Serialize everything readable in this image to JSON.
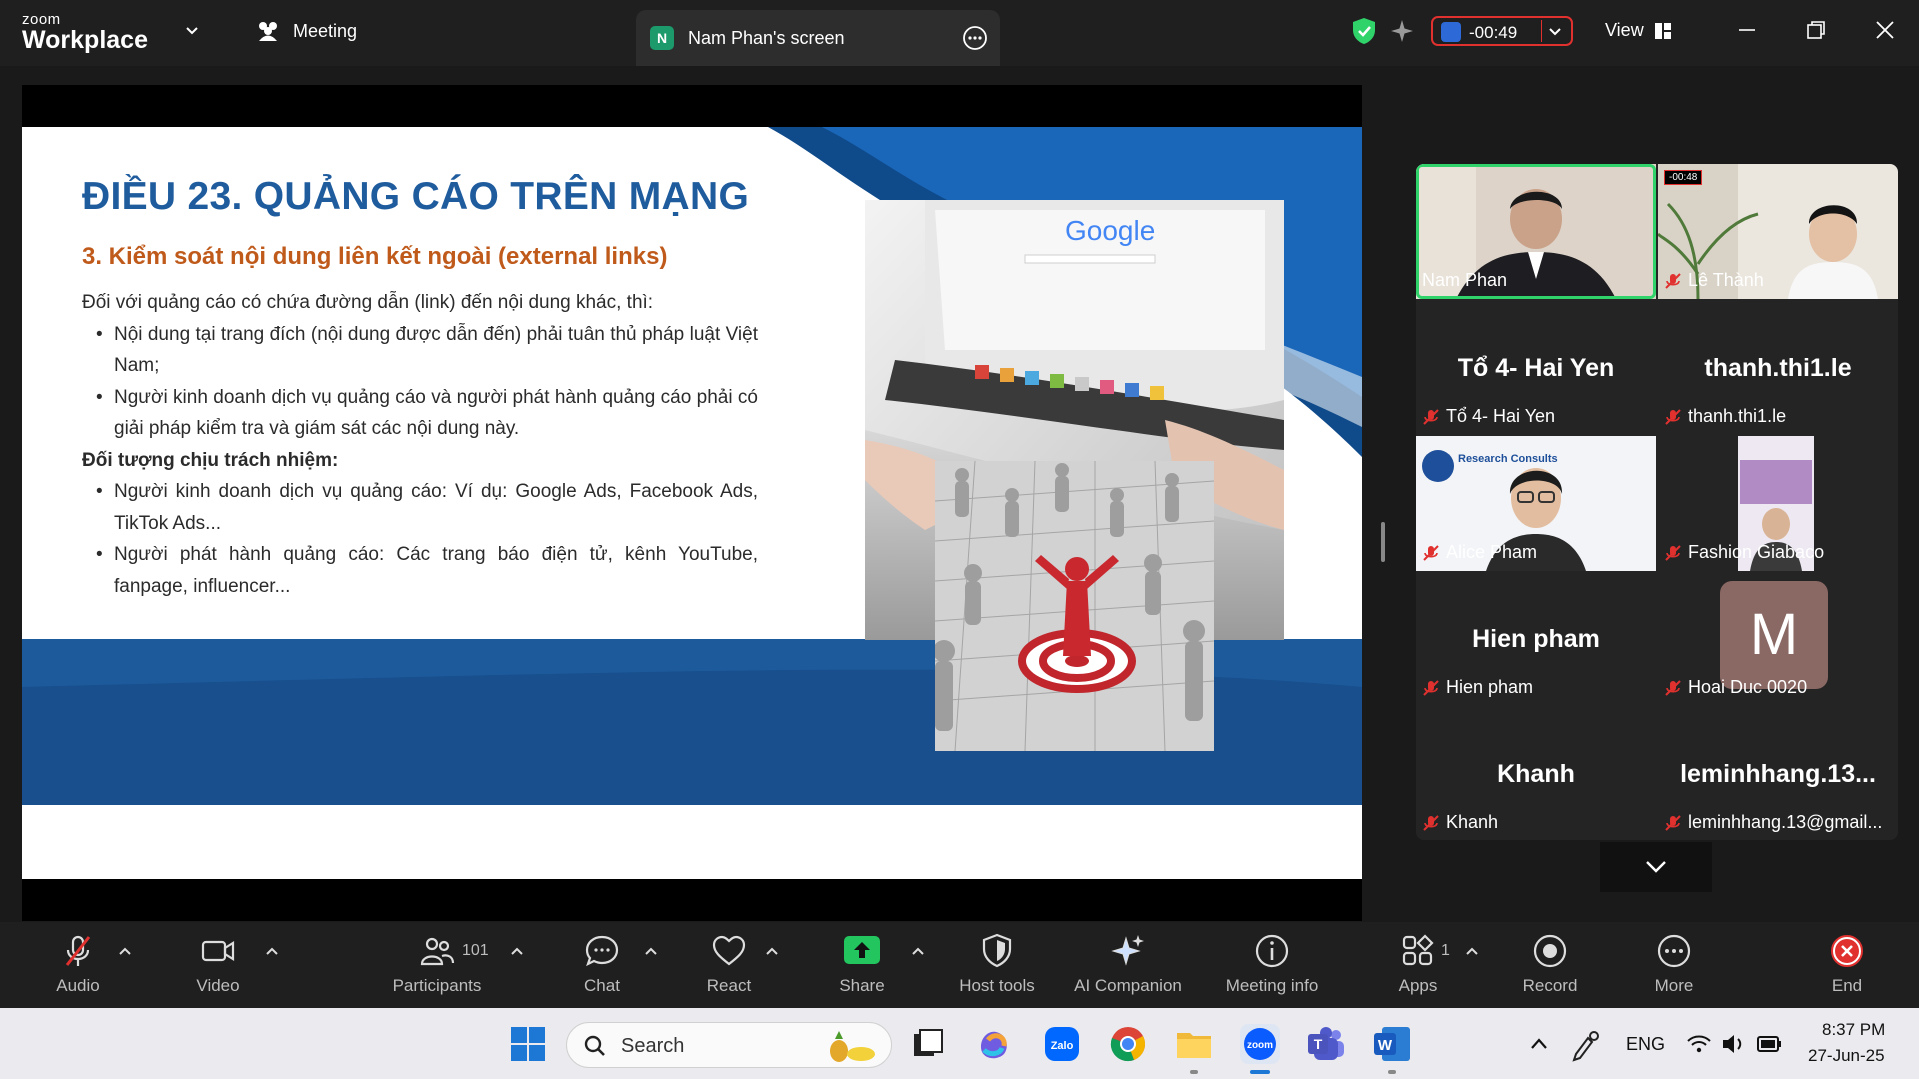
{
  "app": {
    "brand_small": "zoom",
    "brand_big": "Workplace",
    "meeting_tab": "Meeting",
    "share_tab": "Nam Phan's screen",
    "share_initial": "N",
    "timer": "-00:49",
    "view_label": "View"
  },
  "slide": {
    "title": "ĐIỀU 23. QUẢNG CÁO TRÊN MẠNG",
    "subtitle": "3. Kiểm soát nội dung liên kết ngoài (external links)",
    "intro": "Đối với quảng cáo có chứa đường dẫn (link) đến nội dung khác, thì:",
    "bullets_1": [
      "Nội dung tại trang đích (nội dung được dẫn đến) phải tuân thủ pháp luật Việt Nam;",
      "Người kinh doanh dịch vụ quảng cáo và người phát hành quảng cáo phải có giải pháp kiểm tra và giám sát các nội dung này."
    ],
    "heading_2": "Đối tượng chịu trách nhiệm:",
    "bullets_2": [
      "Người kinh doanh dịch vụ quảng cáo: Ví dụ: Google Ads, Facebook Ads, TikTok Ads...",
      "Người phát hành quảng cáo: Các trang báo điện tử, kênh YouTube, fanpage, influencer..."
    ],
    "laptop_logo": "Google"
  },
  "gallery": {
    "tiles": [
      {
        "name": "Nam Phan",
        "big": "",
        "type": "photo",
        "active": true
      },
      {
        "name": "Lê Thành",
        "big": "",
        "type": "photo",
        "active": false,
        "timer": "-00:48"
      },
      {
        "name": "Tổ 4- Hai Yen",
        "big": "Tổ 4- Hai Yen",
        "type": "text",
        "active": false
      },
      {
        "name": "thanh.thi1.le",
        "big": "thanh.thi1.le",
        "type": "text",
        "active": false
      },
      {
        "name": "Alice Pham",
        "big": "",
        "type": "photo",
        "active": false,
        "overlay": "Research Consults"
      },
      {
        "name": "Fashion Giabaco",
        "big": "",
        "type": "photo",
        "active": false
      },
      {
        "name": "Hien pham",
        "big": "Hien pham",
        "type": "text",
        "active": false
      },
      {
        "name": "Hoai Duc 0020",
        "big": "",
        "type": "avatar",
        "avatar": "M",
        "active": false
      },
      {
        "name": "Khanh",
        "big": "Khanh",
        "type": "text",
        "active": false
      },
      {
        "name": "leminhhang.13@gmail...",
        "big": "leminhhang.13...",
        "type": "text",
        "active": false
      }
    ]
  },
  "toolbar": {
    "audio": "Audio",
    "video": "Video",
    "participants": "Participants",
    "participants_count": "101",
    "chat": "Chat",
    "react": "React",
    "share": "Share",
    "host_tools": "Host tools",
    "ai_companion": "AI Companion",
    "meeting_info": "Meeting info",
    "apps": "Apps",
    "apps_count": "1",
    "record": "Record",
    "more": "More",
    "end": "End"
  },
  "taskbar": {
    "search_placeholder": "Search",
    "language": "ENG",
    "time": "8:37 PM",
    "date": "27-Jun-25"
  },
  "colors": {
    "slide_title": "#1f5c9e",
    "slide_subtitle": "#bf5a1b",
    "active_speaker": "#2fd36a",
    "timer_border": "#e0312f",
    "share_green": "#22c55e",
    "end_red": "#e0312f"
  }
}
